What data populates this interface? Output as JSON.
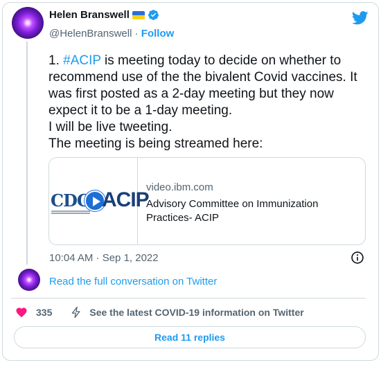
{
  "author": {
    "display_name": "Helen Branswell",
    "handle": "@HelenBranswell",
    "separator": " · ",
    "follow_label": "Follow"
  },
  "tweet": {
    "prefix": "1. ",
    "hashtag": "#ACIP",
    "body": " is meeting today to decide on whether to recommend use of the the bivalent Covid vaccines. It was first posted as a 2-day meeting but they now expect it to be a 1-day meeting.\nI will be live tweeting.\nThe meeting is being streamed here:"
  },
  "link_card": {
    "domain": "video.ibm.com",
    "title": "Advisory Committee on Immunization Practices- ACIP",
    "logo_text_left": "CDC",
    "logo_text_right": "ACIP"
  },
  "timestamp": "10:04 AM · Sep 1, 2022",
  "read_conversation_label": "Read the full conversation on Twitter",
  "actions": {
    "like_count": "335",
    "covid_info_label": "See the latest COVID-19 information on Twitter"
  },
  "replies_button_label": "Read 11 replies",
  "colors": {
    "accent": "#1d9bf0",
    "like": "#f91880",
    "text": "#0f1419",
    "secondary": "#536471",
    "border": "#cfd9de"
  },
  "icons": [
    "avatar",
    "ukraine-flag-icon",
    "verified-badge-icon",
    "twitter-bird-icon",
    "play-icon",
    "info-icon",
    "heart-icon",
    "lightning-icon"
  ]
}
